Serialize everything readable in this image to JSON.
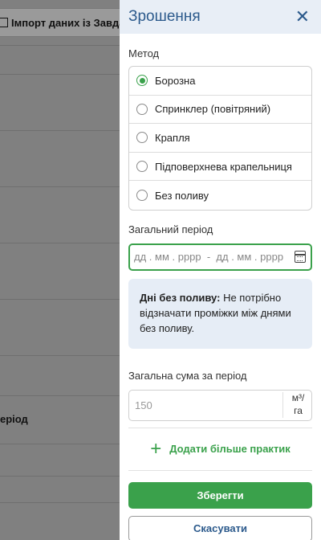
{
  "background": {
    "import_button_label": "Імпорт даних із Завдан",
    "partial_text": "еріод"
  },
  "drawer": {
    "title": "Зрошення",
    "close_icon": "close-icon",
    "method_label": "Метод",
    "methods": [
      {
        "label": "Борозна",
        "checked": true
      },
      {
        "label": "Спринклер (повітряний)",
        "checked": false
      },
      {
        "label": "Крапля",
        "checked": false
      },
      {
        "label": "Підповерхнева крапельниця",
        "checked": false
      },
      {
        "label": "Без поливу",
        "checked": false
      }
    ],
    "period_label": "Загальний період",
    "date_placeholder": "дд . мм . рррр  -  дд . мм . рррр",
    "info_bold": "Дні без поливу:",
    "info_text": " Не потрібно відзначати проміжки між днями без поливу.",
    "total_label": "Загальна сума за період",
    "total_placeholder": "150",
    "unit_top": "м³/",
    "unit_bottom": "га",
    "add_more_label": "Додати більше практик",
    "save_label": "Зберегти",
    "cancel_label": "Скасувати"
  },
  "colors": {
    "accent_green": "#3aa14b",
    "title_blue": "#2c5a8c",
    "info_bg": "#e6edf6"
  }
}
